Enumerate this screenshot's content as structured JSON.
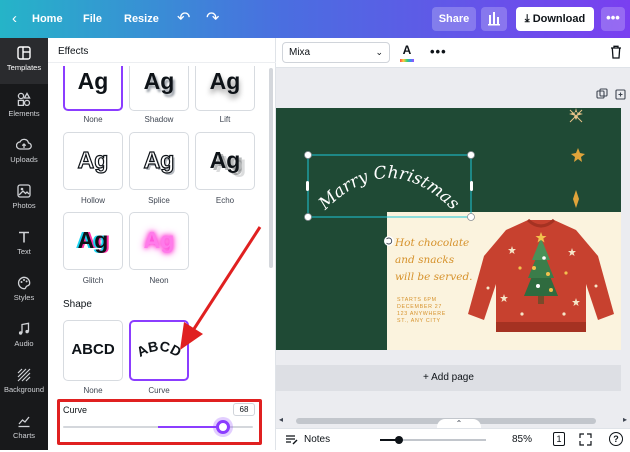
{
  "topbar": {
    "home_label": "Home",
    "file_label": "File",
    "resize_label": "Resize",
    "share_label": "Share",
    "download_label": "Download"
  },
  "sidebar": {
    "items": [
      {
        "label": "Templates",
        "icon": "templates-icon"
      },
      {
        "label": "Elements",
        "icon": "elements-icon"
      },
      {
        "label": "Uploads",
        "icon": "uploads-icon"
      },
      {
        "label": "Photos",
        "icon": "photos-icon"
      },
      {
        "label": "Text",
        "icon": "text-icon"
      },
      {
        "label": "Styles",
        "icon": "styles-icon"
      },
      {
        "label": "Audio",
        "icon": "audio-icon"
      },
      {
        "label": "Background",
        "icon": "background-icon"
      },
      {
        "label": "Charts",
        "icon": "charts-icon"
      }
    ]
  },
  "effects_panel": {
    "title": "Effects",
    "effects": [
      {
        "sample": "Ag",
        "label": "None"
      },
      {
        "sample": "Ag",
        "label": "Shadow"
      },
      {
        "sample": "Ag",
        "label": "Lift"
      },
      {
        "sample": "Ag",
        "label": "Hollow"
      },
      {
        "sample": "Ag",
        "label": "Splice"
      },
      {
        "sample": "Ag",
        "label": "Echo"
      },
      {
        "sample": "Ag",
        "label": "Glitch"
      },
      {
        "sample": "Ag",
        "label": "Neon"
      }
    ],
    "shape_title": "Shape",
    "shapes": [
      {
        "sample": "ABCD",
        "label": "None"
      },
      {
        "sample": "ABCD",
        "label": "Curve"
      }
    ],
    "curve": {
      "label": "Curve",
      "value": "68",
      "level": 68
    }
  },
  "editor_toolbar": {
    "font": "Mixa",
    "text_color": "#3b8ef0"
  },
  "canvas": {
    "headline": "Marry Christmas",
    "body_lines": [
      "Hot chocolate",
      "and snacks",
      "will be served."
    ],
    "details": [
      "STARTS 6PM",
      "DECEMBER 27",
      "123 ANYWHERE",
      "ST., ANY CITY"
    ],
    "add_page_label": "+ Add page",
    "colors": {
      "dark_green": "#1f4a35",
      "cream": "#fbf3de",
      "sweater": "#c7412f",
      "gold": "#e0a43a"
    }
  },
  "bottombar": {
    "notes_label": "Notes",
    "zoom": "85%",
    "page": "1"
  },
  "accent": "#8b3dff",
  "highlight": "#e02020"
}
